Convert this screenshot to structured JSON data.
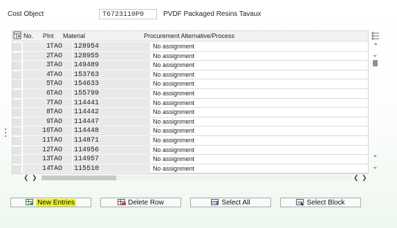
{
  "header": {
    "label": "Cost Object",
    "value": "T6723110P0",
    "description": "PVDF Packaged Resins Tavaux"
  },
  "table": {
    "columns": [
      "No.",
      "Plnt",
      "Material",
      "Procurement Alternative/Process"
    ],
    "rows": [
      {
        "no": "1",
        "plant": "TAO",
        "material": "128954",
        "process": "No assignment"
      },
      {
        "no": "2",
        "plant": "TAO",
        "material": "128955",
        "process": "No assignment"
      },
      {
        "no": "3",
        "plant": "TAO",
        "material": "149489",
        "process": "No assignment"
      },
      {
        "no": "4",
        "plant": "TAO",
        "material": "153763",
        "process": "No assignment"
      },
      {
        "no": "5",
        "plant": "TAO",
        "material": "154633",
        "process": "No assignment"
      },
      {
        "no": "6",
        "plant": "TAO",
        "material": "155799",
        "process": "No assignment"
      },
      {
        "no": "7",
        "plant": "TAO",
        "material": "114441",
        "process": "No assignment"
      },
      {
        "no": "8",
        "plant": "TAO",
        "material": "114442",
        "process": "No assignment"
      },
      {
        "no": "9",
        "plant": "TAO",
        "material": "114447",
        "process": "No assignment"
      },
      {
        "no": "10",
        "plant": "TAO",
        "material": "114448",
        "process": "No assignment"
      },
      {
        "no": "11",
        "plant": "TAO",
        "material": "114871",
        "process": "No assignment"
      },
      {
        "no": "12",
        "plant": "TAO",
        "material": "114956",
        "process": "No assignment"
      },
      {
        "no": "13",
        "plant": "TAO",
        "material": "114957",
        "process": "No assignment"
      },
      {
        "no": "14",
        "plant": "TAO",
        "material": "115510",
        "process": "No assignment"
      }
    ]
  },
  "buttons": {
    "new_entries": "New Entries",
    "delete_row": "Delete Row",
    "select_all": "Select All",
    "select_block": "Select Block"
  },
  "icons": {
    "config": "table-settings-icon",
    "new_entries": "new-entries-icon",
    "delete_row": "delete-row-icon",
    "select_all": "select-all-icon",
    "select_block": "select-block-icon"
  },
  "colors": {
    "highlight": "#eef22a",
    "key_cell_bg": "#e9e9e9",
    "header_bg": "#f2f2f2"
  }
}
